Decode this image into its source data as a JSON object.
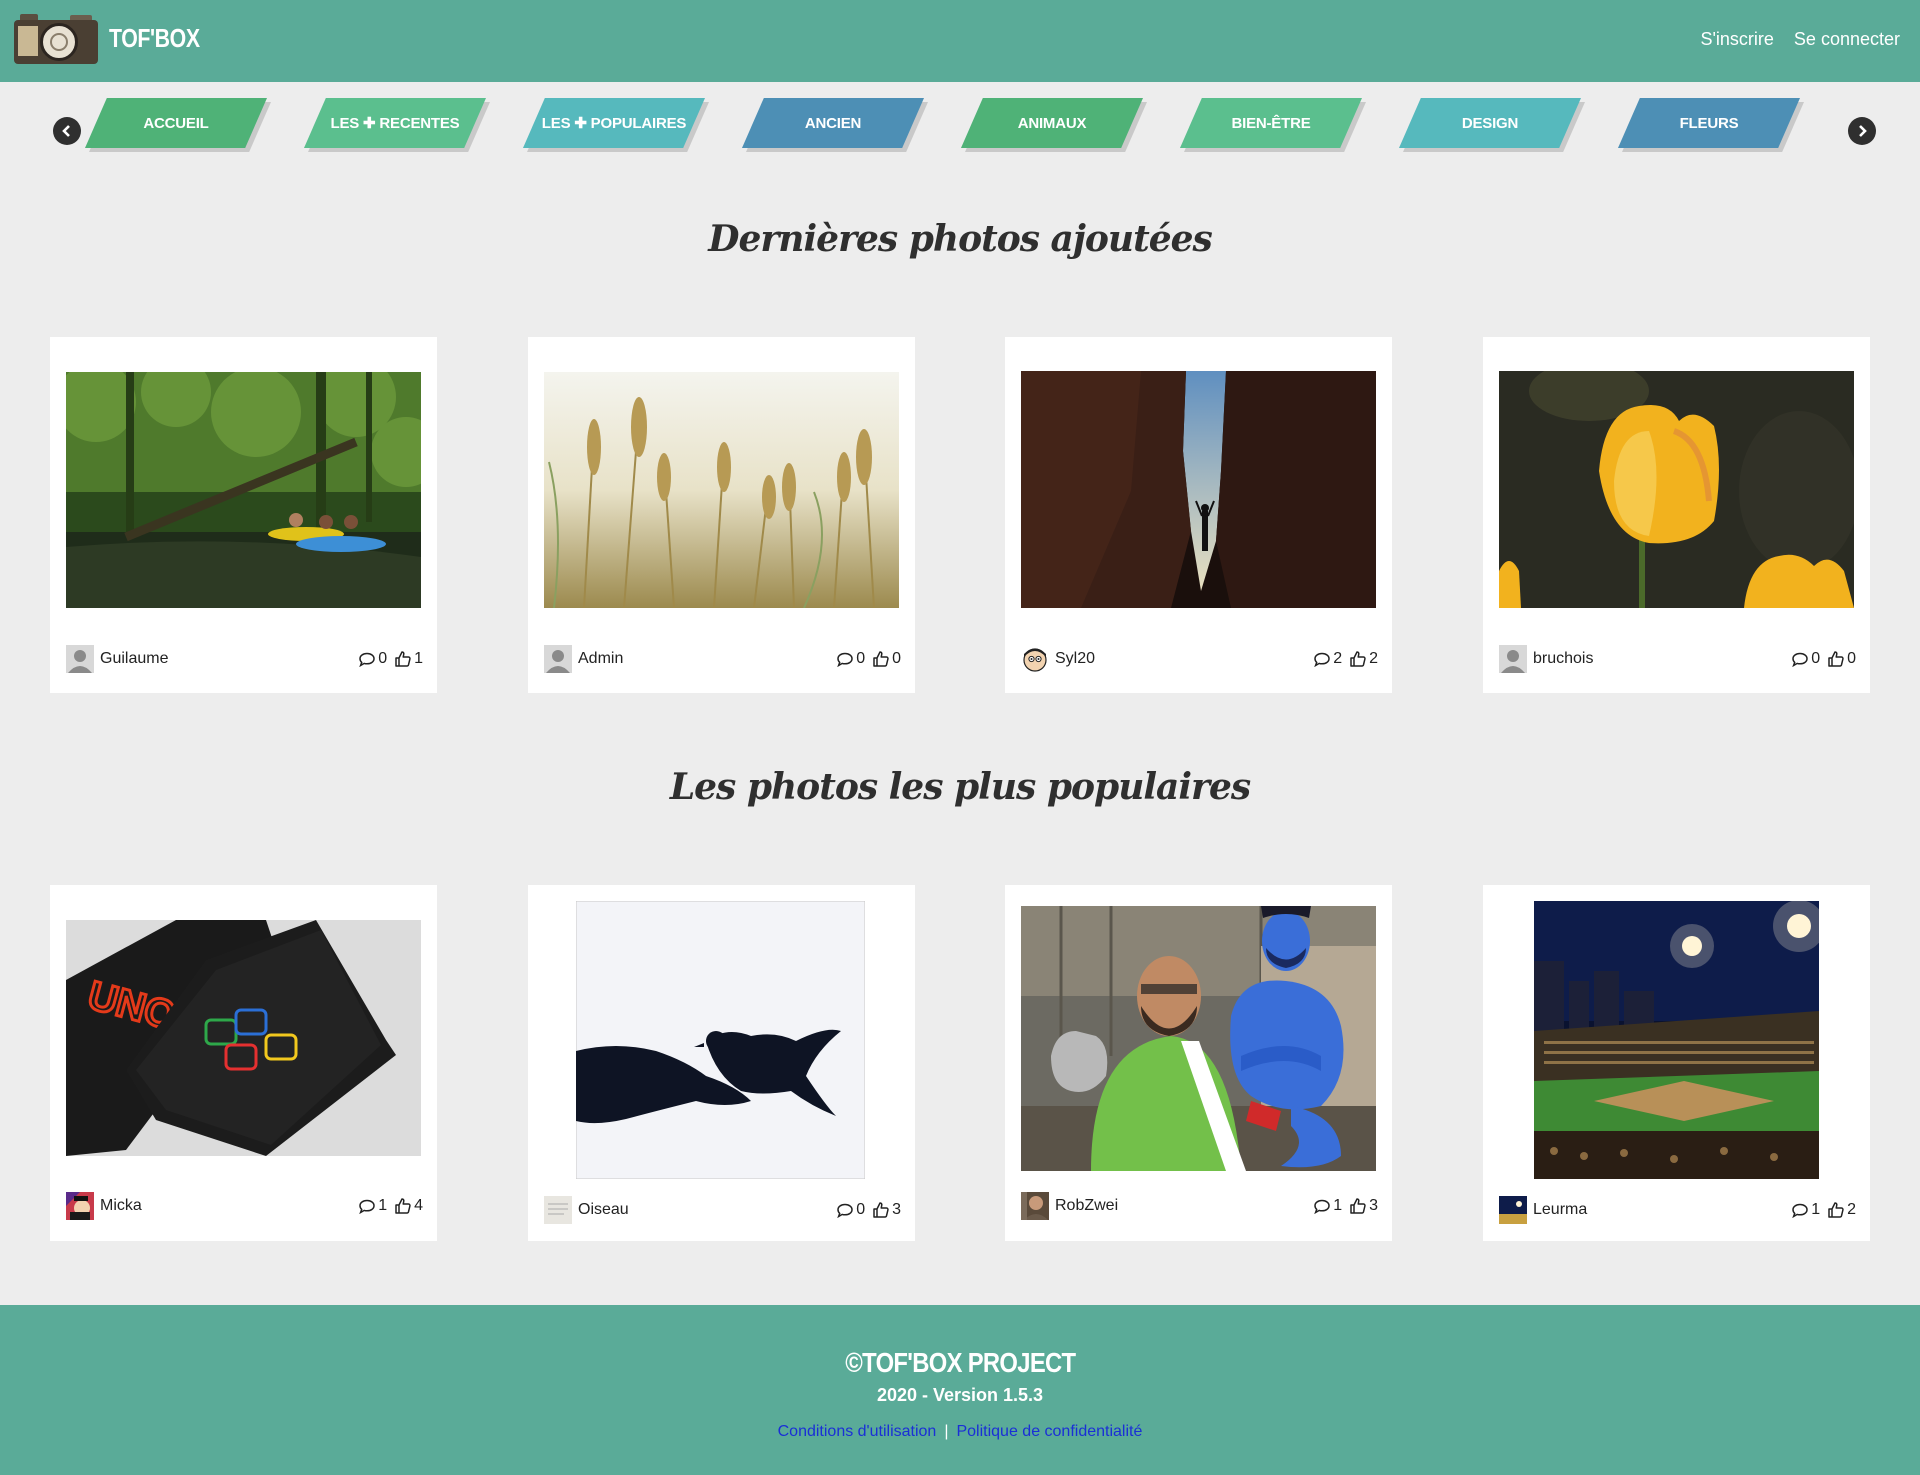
{
  "header": {
    "logo_text": "TOF'BOX",
    "links": [
      "S'inscrire",
      "Se connecter"
    ]
  },
  "categories": [
    {
      "label": "ACCUEIL",
      "color": "#4fb277"
    },
    {
      "label": "LES ✚ RECENTES",
      "color": "#5bbf8e"
    },
    {
      "label": "LES ✚ POPULAIRES",
      "color": "#56b9bd"
    },
    {
      "label": "ANCIEN",
      "color": "#4d8fb5"
    },
    {
      "label": "ANIMAUX",
      "color": "#4fb277"
    },
    {
      "label": "BIEN-ÊTRE",
      "color": "#5bbf8e"
    },
    {
      "label": "DESIGN",
      "color": "#56b9bd"
    },
    {
      "label": "FLEURS",
      "color": "#4d8fb5"
    }
  ],
  "sections": {
    "latest_title": "Dernières photos ajoutées",
    "popular_title": "Les photos les plus populaires"
  },
  "latest": [
    {
      "user": "Guilaume",
      "comments": "0",
      "likes": "1",
      "image": "jungle-kayak-photo"
    },
    {
      "user": "Admin",
      "comments": "0",
      "likes": "0",
      "image": "wheat-field-photo"
    },
    {
      "user": "Syl20",
      "comments": "2",
      "likes": "2",
      "image": "canyon-photo"
    },
    {
      "user": "bruchois",
      "comments": "0",
      "likes": "0",
      "image": "tulip-photo"
    }
  ],
  "popular": [
    {
      "user": "Micka",
      "comments": "1",
      "likes": "4",
      "image": "uno-cards-photo"
    },
    {
      "user": "Oiseau",
      "comments": "0",
      "likes": "3",
      "image": "bird-hand-photo"
    },
    {
      "user": "RobZwei",
      "comments": "1",
      "likes": "3",
      "image": "genie-photo"
    },
    {
      "user": "Leurma",
      "comments": "1",
      "likes": "2",
      "image": "stadium-photo"
    }
  ],
  "footer": {
    "title": "©TOF'BOX PROJECT",
    "version": "2020 - Version 1.5.3",
    "link_terms": "Conditions d'utilisation",
    "separator": "|",
    "link_privacy": "Politique de confidentialité"
  }
}
